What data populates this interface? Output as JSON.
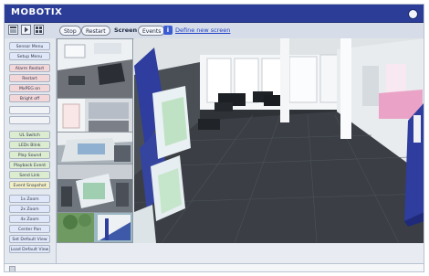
{
  "app": {
    "brand": "MOBOTIX"
  },
  "toolbar": {
    "icons": [
      "layout-icon",
      "play-icon",
      "grid-icon"
    ],
    "stop_label": "Stop",
    "restart_label": "Restart",
    "screen_label": "Screen",
    "events_label": "Events",
    "info_symbol": "i",
    "define_link": "Define new screen"
  },
  "sidebar": {
    "buttons": [
      {
        "label": "Sensor Menu",
        "color": "blue"
      },
      {
        "label": "Setup Menu",
        "color": "blue"
      },
      {
        "label": "Alarm Restart",
        "color": "pink"
      },
      {
        "label": "Restart",
        "color": "pink"
      },
      {
        "label": "MxPEG on",
        "color": "pink"
      },
      {
        "label": "Bright off",
        "color": "pink"
      },
      {
        "label": "",
        "color": "blank"
      },
      {
        "label": "",
        "color": "blank"
      },
      {
        "label": "UL Switch",
        "color": "green"
      },
      {
        "label": "LEDs Blink",
        "color": "green"
      },
      {
        "label": "Play Sound",
        "color": "green"
      },
      {
        "label": "Playback Event",
        "color": "green"
      },
      {
        "label": "Send Link",
        "color": "green"
      },
      {
        "label": "Event Snapshot",
        "color": "yellow"
      },
      {
        "label": "1x Zoom",
        "color": "blue"
      },
      {
        "label": "2x Zoom",
        "color": "blue"
      },
      {
        "label": "4x Zoom",
        "color": "blue"
      },
      {
        "label": "Center Pan",
        "color": "blue"
      },
      {
        "label": "Set Default View",
        "color": "blue"
      },
      {
        "label": "Load Default View",
        "color": "blue"
      }
    ]
  },
  "colors": {
    "titlebar": "#2b3d97",
    "link": "#2241c4",
    "accent_column": "#2e3d9e"
  }
}
